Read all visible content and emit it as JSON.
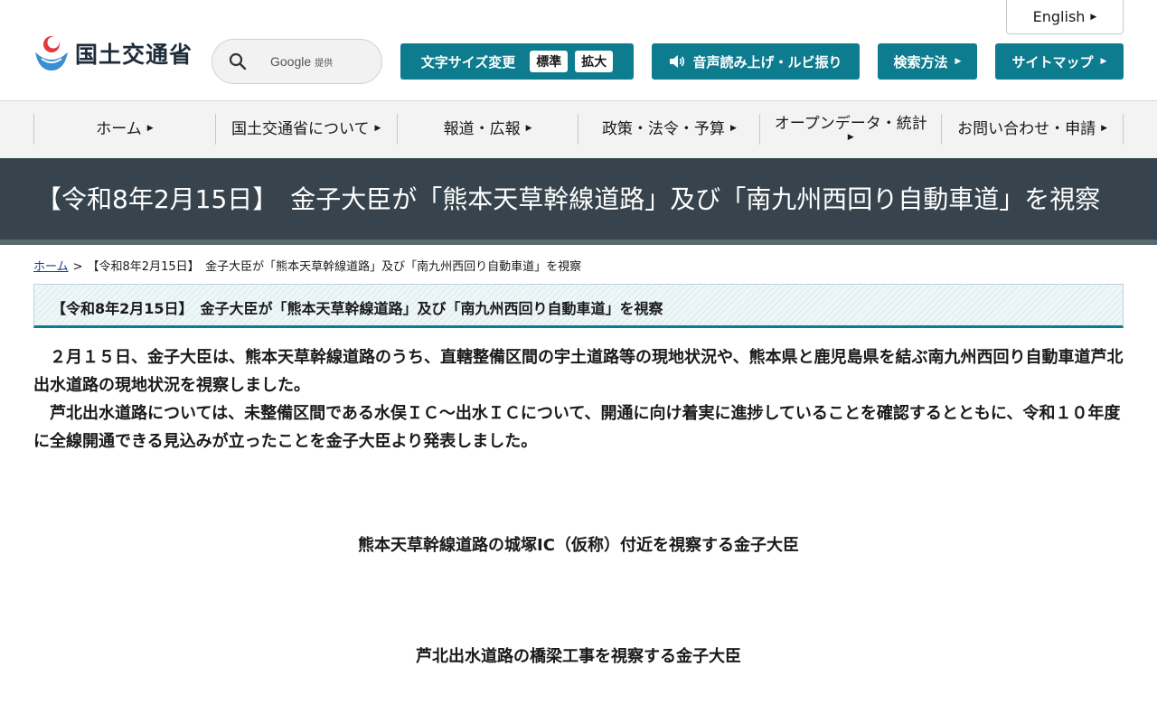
{
  "header": {
    "english_label": "English",
    "logo_text": "国土交通省",
    "search": {
      "provider": "Google",
      "provider_suffix": "提供"
    },
    "tools": {
      "text_size_label": "文字サイズ変更",
      "text_size_standard": "標準",
      "text_size_large": "拡大",
      "voice_label": "音声読み上げ・ルビ振り",
      "search_method_label": "検索方法",
      "sitemap_label": "サイトマップ"
    }
  },
  "nav": {
    "items": [
      {
        "label": "ホーム"
      },
      {
        "label": "国土交通省について"
      },
      {
        "label": "報道・広報"
      },
      {
        "label": "政策・法令・予算"
      },
      {
        "label": "オープンデータ・統計"
      },
      {
        "label": "お問い合わせ・申請"
      }
    ]
  },
  "page": {
    "title": "【令和8年2月15日】　金子大臣が「熊本天草幹線道路」及び「南九州西回り自動車道」を視察"
  },
  "breadcrumb": {
    "home": "ホーム",
    "separator": ">",
    "current": "【令和8年2月15日】　金子大臣が「熊本天草幹線道路」及び「南九州西回り自動車道」を視察"
  },
  "article": {
    "heading": "【令和8年2月15日】　金子大臣が「熊本天草幹線道路」及び「南九州西回り自動車道」を視察",
    "paragraphs": [
      "２月１５日、金子大臣は、熊本天草幹線道路のうち、直轄整備区間の宇土道路等の現地状況や、熊本県と鹿児島県を結ぶ南九州西回り自動車道芦北出水道路の現地状況を視察しました。",
      "芦北出水道路については、未整備区間である水俣ＩＣ～出水ＩＣについて、開通に向け着実に進捗していることを確認するとともに、令和１０年度に全線開通できる見込みが立ったことを金子大臣より発表しました。"
    ],
    "captions": [
      "熊本天草幹線道路の城塚IC（仮称）付近を視察する金子大臣",
      "芦北出水道路の橋梁工事を視察する金子大臣"
    ]
  },
  "colors": {
    "accent": "#0e7c8f",
    "banner": "#37444d",
    "nav_bg": "#f3f3f3"
  }
}
